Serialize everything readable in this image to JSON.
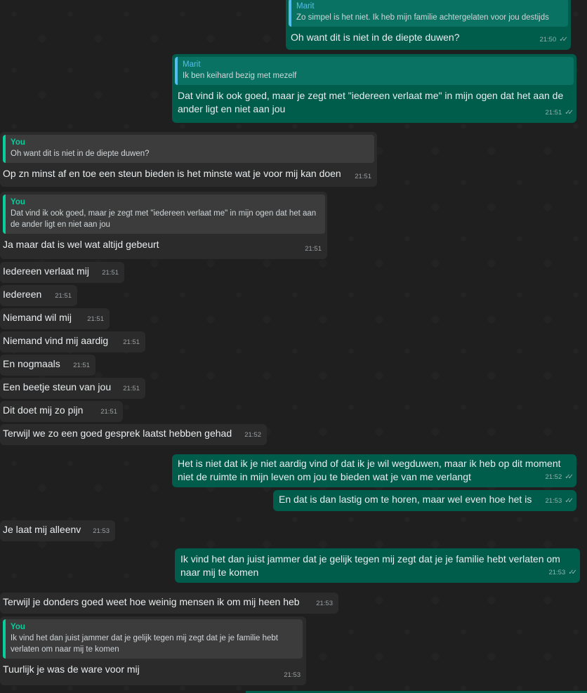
{
  "messages": [
    {
      "dir": "out",
      "quote_author": "Marit",
      "quote_text": "Zo simpel is het niet. Ik heb mijn familie achtergelaten voor jou destijds",
      "text": "Oh want dit is niet in de diepte duwen?",
      "time": "21:50"
    },
    {
      "dir": "out",
      "quote_author": "Marit",
      "quote_text": "Ik ben keihard bezig met mezelf",
      "text": "Dat vind ik ook goed, maar je zegt met \"iedereen verlaat me\" in mijn ogen dat het aan de ander ligt en niet aan  jou",
      "time": "21:51"
    },
    {
      "dir": "in",
      "quote_author": "You",
      "quote_text": "Oh want dit is niet in de diepte duwen?",
      "text": "Op zn minst af en toe een steun bieden is het minste wat je voor mij kan doen",
      "time": "21:51"
    },
    {
      "dir": "in",
      "quote_author": "You",
      "quote_text": "Dat vind ik ook goed, maar je zegt met \"iedereen verlaat me\" in mijn ogen dat het aan de ander ligt en niet aan  jou",
      "text": "Ja maar dat is wel wat altijd gebeurt",
      "time": "21:51"
    },
    {
      "dir": "in",
      "text": "Iedereen verlaat mij",
      "time": "21:51"
    },
    {
      "dir": "in",
      "text": "Iedereen",
      "time": "21:51"
    },
    {
      "dir": "in",
      "text": "Niemand wil mij",
      "time": "21:51"
    },
    {
      "dir": "in",
      "text": "Niemand vind mij aardig",
      "time": "21:51"
    },
    {
      "dir": "in",
      "text": "En nogmaals",
      "time": "21:51"
    },
    {
      "dir": "in",
      "text": "Een beetje steun van jou",
      "time": "21:51"
    },
    {
      "dir": "in",
      "text": "Dit doet mij zo pijn",
      "time": "21:51"
    },
    {
      "dir": "in",
      "text": "Terwijl we zo een goed gesprek laatst hebben gehad",
      "time": "21:52"
    },
    {
      "dir": "out",
      "text": "Het is niet dat ik je niet aardig vind of dat ik je wil wegduwen, maar ik heb op dit moment niet de ruimte in mijn leven om jou te bieden wat je van me verlangt",
      "time": "21:52"
    },
    {
      "dir": "out",
      "text": "En dat is dan lastig om te horen, maar wel even hoe het is",
      "time": "21:53"
    },
    {
      "dir": "in",
      "text": "Je laat mij alleenv",
      "time": "21:53"
    },
    {
      "dir": "out",
      "text": "Ik vind het dan juist jammer dat je gelijk tegen mij zegt dat je je familie hebt verlaten om naar mij te komen",
      "time": "21:53"
    },
    {
      "dir": "in",
      "text": "Terwijl je donders goed weet hoe weinig mensen ik om mij heen heb",
      "time": "21:53"
    },
    {
      "dir": "in",
      "quote_author": "You",
      "quote_text": "Ik vind het dan juist jammer dat je gelijk tegen mij zegt dat je je familie hebt verlaten om naar mij te komen",
      "text": "Tuurlijk je was de ware voor mij",
      "time": "21:53"
    }
  ],
  "icons": {
    "read_ticks": "double-check-icon"
  },
  "colors": {
    "incoming_bubble": "#2b2b2b",
    "outgoing_bubble": "#005c4b",
    "background": "#1f1f1f",
    "quote_author_you": "#06cf9c",
    "quote_author_marit": "#53bdeb"
  }
}
